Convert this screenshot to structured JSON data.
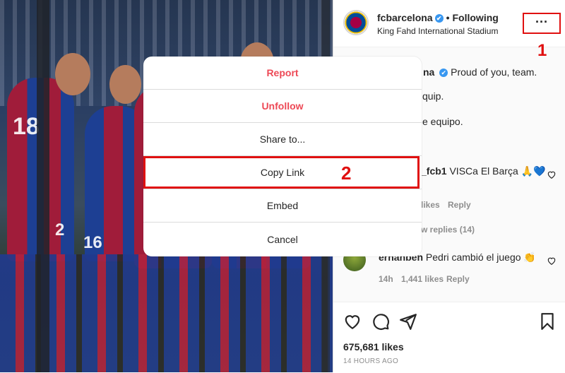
{
  "post": {
    "username": "fcbarcelona",
    "verified_mark": "✔",
    "separator": "•",
    "follow_status": "Following",
    "location": "King Fahd International Stadium",
    "more_icon_text": "···"
  },
  "annotations": {
    "one": "1",
    "two": "2"
  },
  "comments": [
    {
      "user": "fcbarcelona",
      "text": "Proud of you, team.",
      "partial_user": "na"
    },
    {
      "text": "quip."
    },
    {
      "text": "e equipo."
    },
    {
      "user_partial": "_fcb1",
      "text": "VISCa El Barça 🙏💙",
      "likes": "likes",
      "reply": "Reply"
    },
    {
      "view_replies": "w replies (14)"
    },
    {
      "user": "erhanben",
      "text": "Pedri cambió el juego 👏",
      "time": "14h",
      "likes": "1,441 likes",
      "reply": "Reply"
    }
  ],
  "actions": {
    "likes": "675,681 likes",
    "time": "14 HOURS AGO"
  },
  "menu": {
    "items": [
      "Report",
      "Unfollow",
      "Share to...",
      "Copy Link",
      "Embed",
      "Cancel"
    ]
  },
  "photo": {
    "jersey_numbers": [
      "18",
      "16",
      "2"
    ]
  },
  "colors": {
    "danger": "#ed4956",
    "annotation": "#e01010",
    "verified": "#3897f0"
  }
}
